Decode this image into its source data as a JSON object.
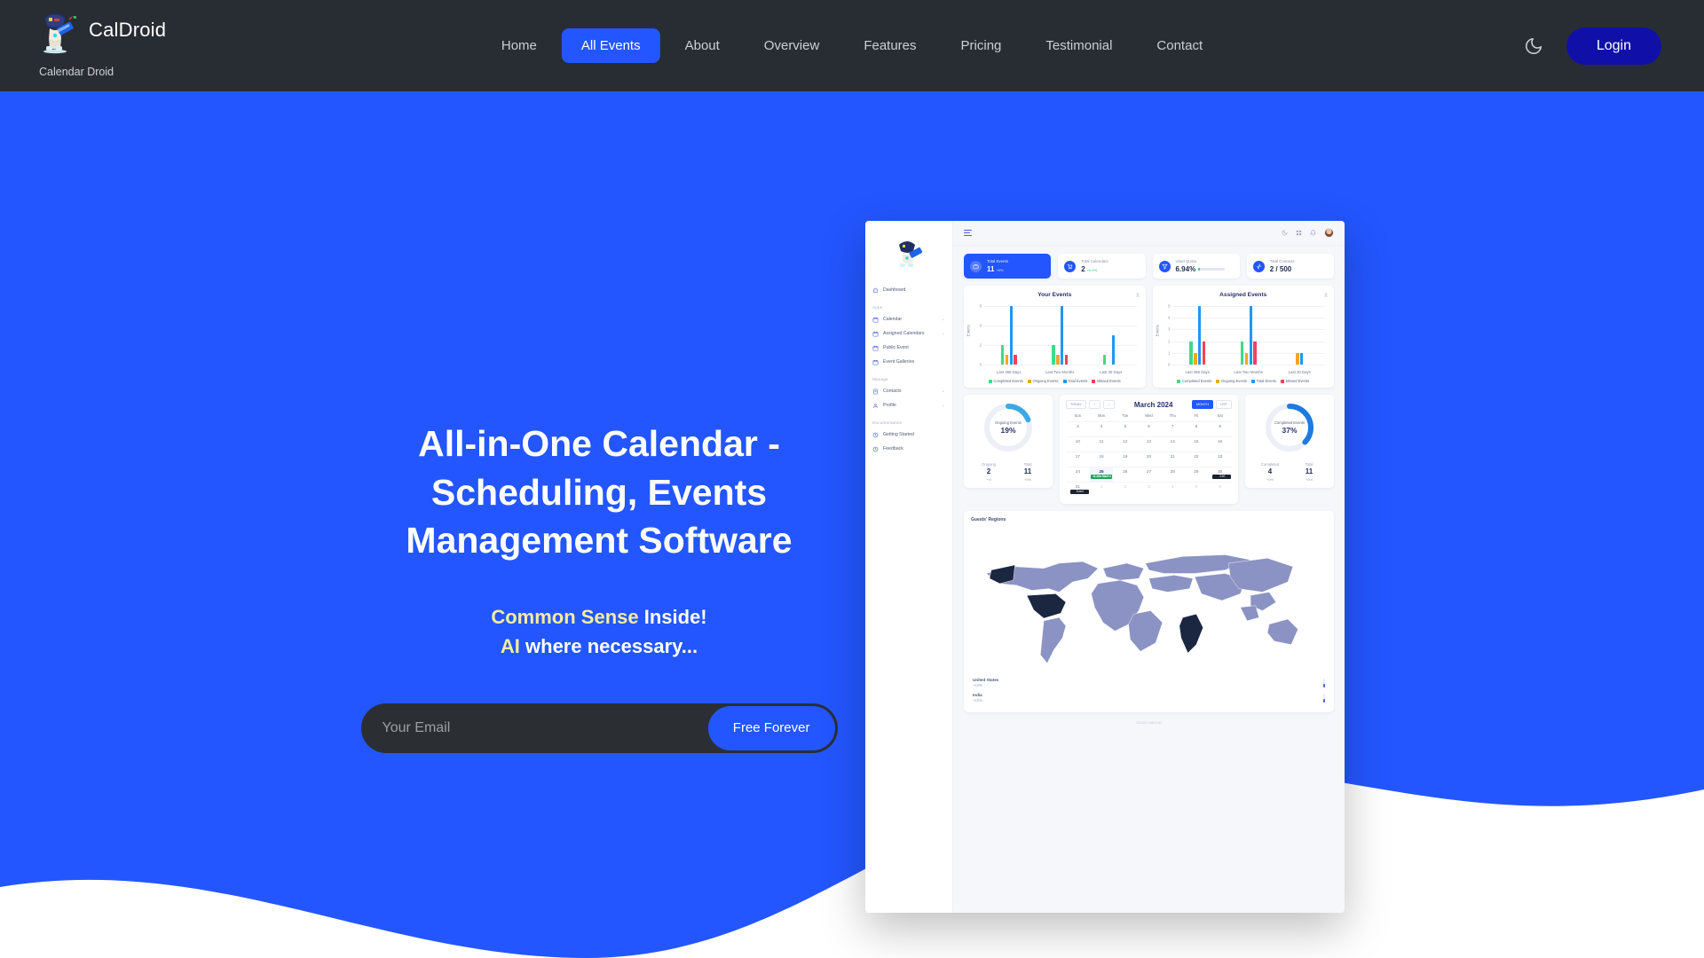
{
  "navbar": {
    "brand_name": "CalDroid",
    "brand_sub": "Calendar Droid",
    "logo_icon": "robot-droid-logo",
    "links": [
      {
        "label": "Home",
        "active": false
      },
      {
        "label": "All Events",
        "active": true
      },
      {
        "label": "About",
        "active": false
      },
      {
        "label": "Overview",
        "active": false
      },
      {
        "label": "Features",
        "active": false
      },
      {
        "label": "Pricing",
        "active": false
      },
      {
        "label": "Testimonial",
        "active": false
      },
      {
        "label": "Contact",
        "active": false
      }
    ],
    "theme_toggle_icon": "moon-icon",
    "login_label": "Login",
    "bg_color": "#282d33",
    "accent_color": "#2356ff",
    "login_color": "#1010a8"
  },
  "hero": {
    "title": "All-in-One Calendar - Scheduling, Events Management Software",
    "sub_line1_highlight": "Common Sense",
    "sub_line1_rest": " Inside!",
    "sub_line2_highlight": "AI",
    "sub_line2_rest": " where necessary...",
    "email_placeholder": "Your Email",
    "email_value": "",
    "cta_label": "Free Forever",
    "bg_color": "#2356ff",
    "highlight_color": "#f5ee9e"
  },
  "scroll_top_icon": "arrow-up-icon",
  "dashboard": {
    "sidebar": {
      "logo_icon": "robot-droid-logo",
      "items": [
        {
          "label": "Dashboard",
          "icon": "home-icon",
          "group": null,
          "caret": false
        },
        {
          "label": "Calendar",
          "icon": "calendar-icon",
          "group": "Apps",
          "caret": true
        },
        {
          "label": "Assigned Calendars",
          "icon": "calendar-icon",
          "group": "Apps",
          "caret": true
        },
        {
          "label": "Public Event",
          "icon": "calendar-icon",
          "group": "Apps",
          "caret": false
        },
        {
          "label": "Event Galleries",
          "icon": "calendar-icon",
          "group": "Apps",
          "caret": false
        },
        {
          "label": "Contacts",
          "icon": "contacts-icon",
          "group": "Manage",
          "caret": true
        },
        {
          "label": "Profile",
          "icon": "user-icon",
          "group": "Manage",
          "caret": true
        },
        {
          "label": "Getting Started",
          "icon": "clock-icon",
          "group": "Documentation",
          "caret": false
        },
        {
          "label": "Feedback",
          "icon": "clock-icon",
          "group": "Documentation",
          "caret": false
        }
      ],
      "groups": [
        "Apps",
        "Manage",
        "Documentation"
      ]
    },
    "topbar": {
      "menu_icon": "hamburger-icon",
      "icons": [
        "moon-icon",
        "grid-icon",
        "bell-icon"
      ],
      "avatar": "user-avatar"
    },
    "stat_cards": [
      {
        "label": "Total Events",
        "value": "11",
        "delta": "+0%",
        "icon": "briefcase-icon",
        "accent": true
      },
      {
        "label": "Total Calendars",
        "value": "2",
        "delta": "+0.0%",
        "icon": "cart-icon",
        "accent": false
      },
      {
        "label": "Used Quota",
        "value": "6.94%",
        "delta": "",
        "icon": "funnel-icon",
        "accent": false,
        "has_bar": true
      },
      {
        "label": "Total Contacts",
        "value": "2 / 500",
        "delta": "",
        "icon": "activity-icon",
        "accent": false
      }
    ],
    "calendar": {
      "today_label": "TODAY",
      "prev_label": "‹",
      "next_label": "›",
      "title": "March 2024",
      "month_label": "MONTH",
      "list_label": "LIST",
      "dow": [
        "Sun",
        "Mon",
        "Tue",
        "Wed",
        "Thu",
        "Fri",
        "Sat"
      ],
      "weeks": [
        [
          {
            "d": "3"
          },
          {
            "d": "4"
          },
          {
            "d": "5"
          },
          {
            "d": "6"
          },
          {
            "d": "7"
          },
          {
            "d": "8"
          },
          {
            "d": "9"
          }
        ],
        [
          {
            "d": "10"
          },
          {
            "d": "11"
          },
          {
            "d": "12"
          },
          {
            "d": "13"
          },
          {
            "d": "14"
          },
          {
            "d": "15"
          },
          {
            "d": "16"
          }
        ],
        [
          {
            "d": "17"
          },
          {
            "d": "18"
          },
          {
            "d": "19"
          },
          {
            "d": "20"
          },
          {
            "d": "21"
          },
          {
            "d": "22"
          },
          {
            "d": "23"
          }
        ],
        [
          {
            "d": "24"
          },
          {
            "d": "25",
            "today": true,
            "event": "11:40a Mark's",
            "event_style": "green"
          },
          {
            "d": "26"
          },
          {
            "d": "27"
          },
          {
            "d": "28"
          },
          {
            "d": "29"
          },
          {
            "d": "30",
            "event": "3:30",
            "event_style": "dark"
          }
        ],
        [
          {
            "d": "31",
            "event": "Event",
            "event_style": "dark"
          },
          {
            "d": "1",
            "muted": true
          },
          {
            "d": "2",
            "muted": true
          },
          {
            "d": "3",
            "muted": true
          },
          {
            "d": "4",
            "muted": true
          },
          {
            "d": "5",
            "muted": true
          },
          {
            "d": "6",
            "muted": true
          }
        ]
      ]
    },
    "donuts": [
      {
        "caption": "Ongoing Events",
        "pct": "19%",
        "pct_num": 19,
        "left_label": "Ongoing",
        "left_value": "2",
        "left_delta": "+%",
        "right_label": "Total",
        "right_value": "11",
        "right_delta": "+0%",
        "color": "#3ea8e5"
      },
      {
        "caption": "Completed Events",
        "pct": "37%",
        "pct_num": 37,
        "left_label": "Completed",
        "left_value": "4",
        "left_delta": "+0%",
        "right_label": "Total",
        "right_value": "11",
        "right_delta": "+0%",
        "color": "#1f7ae0"
      }
    ],
    "map": {
      "title": "Guests' Regions",
      "regions": [
        {
          "name": "United States",
          "pct": "+10%"
        },
        {
          "name": "India",
          "pct": "+10%"
        }
      ]
    },
    "footer": "©2024 CalDroid"
  },
  "chart_data": [
    {
      "type": "bar",
      "title": "Your Events",
      "xlabel": "",
      "ylabel": "Events",
      "categories": [
        "Last 365 Days",
        "Last Two Months",
        "Last 30 Days"
      ],
      "series": [
        {
          "name": "Completed Events",
          "color": "#3ddc84",
          "values": [
            2,
            2,
            1
          ]
        },
        {
          "name": "Ongoing Events",
          "color": "#f5a623",
          "values": [
            1,
            1,
            0
          ]
        },
        {
          "name": "Total Events",
          "color": "#2196f3",
          "values": [
            6,
            6,
            3
          ]
        },
        {
          "name": "Missed Events",
          "color": "#f2415a",
          "values": [
            1,
            1,
            0
          ]
        }
      ],
      "ylim": [
        0,
        6
      ],
      "yticks": [
        0,
        2,
        4,
        6
      ],
      "grid": true,
      "legend_position": "bottom"
    },
    {
      "type": "bar",
      "title": "Assigned Events",
      "xlabel": "",
      "ylabel": "Events",
      "categories": [
        "Last 365 Days",
        "Last Two Months",
        "Last 30 Days"
      ],
      "series": [
        {
          "name": "Completed Events",
          "color": "#3ddc84",
          "values": [
            2,
            2,
            0
          ]
        },
        {
          "name": "Ongoing Events",
          "color": "#f5a623",
          "values": [
            1,
            1,
            1
          ]
        },
        {
          "name": "Total Events",
          "color": "#2196f3",
          "values": [
            5,
            5,
            1
          ]
        },
        {
          "name": "Missed Events",
          "color": "#f2415a",
          "values": [
            2,
            2,
            0
          ]
        }
      ],
      "ylim": [
        0,
        5
      ],
      "yticks": [
        0,
        1,
        2,
        3,
        4,
        5
      ],
      "grid": true,
      "legend_position": "bottom"
    }
  ]
}
